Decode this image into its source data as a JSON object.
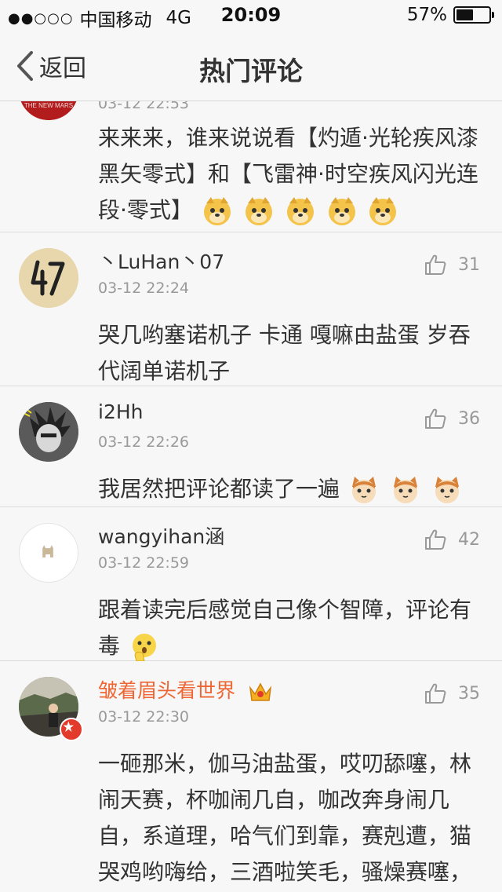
{
  "status_bar": {
    "signal": "●●○○○",
    "carrier": "中国移动",
    "network": "4G",
    "time": "20:09",
    "battery_percent": "57%",
    "battery_level": 0.57
  },
  "nav": {
    "back_label": "返回",
    "title": "热门评论"
  },
  "colors": {
    "vip_name": "#ee6633",
    "badge": "#e23b2b",
    "text": "#333333",
    "meta": "#999999"
  },
  "comments": [
    {
      "username": "",
      "time": "03-12 22:53",
      "likes": "",
      "content": "来来来，谁来说说看【灼遁·光轮疾风漆黑矢零式】和【飞雷神·时空疾风闪光连段·零式】",
      "emoji": "doge",
      "emoji_count": 5,
      "avatar": "avatar-the-new-mars",
      "avatar_text": "THE NEW MARS"
    },
    {
      "username": "丶LuHan丶07",
      "time": "03-12 22:24",
      "likes": "31",
      "content": "哭几哟塞诺机子 卡通 嘎嘛由盐蛋 岁吞 代阔单诺机子",
      "avatar": "avatar-47-logo"
    },
    {
      "username": "i2Hh",
      "time": "03-12 22:26",
      "likes": "36",
      "content": "我居然把评论都读了一遍",
      "emoji": "cat",
      "emoji_count": 3,
      "avatar": "avatar-anime"
    },
    {
      "username": "wangyihan涵",
      "time": "03-12 22:59",
      "likes": "42",
      "content": "跟着读完后感觉自己像个智障，评论有毒",
      "emoji": "thinking",
      "emoji_count": 1,
      "avatar": "avatar-deer"
    },
    {
      "username": "皱着眉头看世界",
      "time": "03-12 22:30",
      "likes": "35",
      "content": "一砸那米，伽马油盐蛋，哎叨舔噻，林闹天赛，杯咖闹几自，咖改奔身闹几自，系道理，哈气们到靠，赛剋遭，猫哭鸡哟嗨给，三酒啦笑毛，骚燥赛噻，就开靠汤，一脚带苏",
      "avatar": "avatar-person",
      "vip": true
    }
  ]
}
